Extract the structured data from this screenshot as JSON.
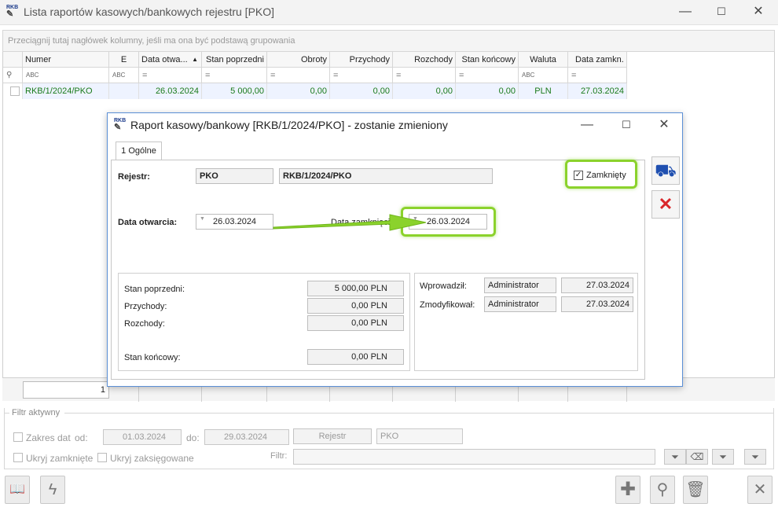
{
  "window": {
    "logo": "RKB",
    "title": "Lista raportów kasowych/bankowych rejestru [PKO]",
    "min": "—",
    "max": "☐",
    "close": "✕"
  },
  "grid": {
    "group_hint": "Przeciągnij tutaj nagłówek kolumny, jeśli ma ona być podstawą grupowania",
    "columns": [
      "Numer",
      "E",
      "Data otwa...",
      "Stan poprzedni",
      "Obroty",
      "Przychody",
      "Rozchody",
      "Stan końcowy",
      "Waluta",
      "Data zamkn."
    ],
    "sort_indicator": "▲",
    "filters": [
      "ABC",
      "ABC",
      "=",
      "=",
      "=",
      "=",
      "=",
      "=",
      "ABC",
      "="
    ],
    "row": [
      "RKB/1/2024/PKO",
      "",
      "26.03.2024",
      "5 000,00",
      "0,00",
      "0,00",
      "0,00",
      "0,00",
      "PLN",
      "27.03.2024"
    ],
    "footer_count": "1"
  },
  "filter_panel": {
    "legend": "Filtr aktywny",
    "date_range": "Zakres dat",
    "from_label": "od:",
    "from_value": "01.03.2024",
    "to_label": "do:",
    "to_value": "29.03.2024",
    "register_button": "Rejestr",
    "register_value": "PKO",
    "hide_closed": "Ukryj zamknięte",
    "hide_posted": "Ukryj zaksięgowane",
    "filter_label": "Filtr:"
  },
  "dialog": {
    "logo": "RKB",
    "title": "Raport kasowy/bankowy [RKB/1/2024/PKO] - zostanie zmieniony",
    "tab": "1 Ogólne",
    "register_label": "Rejestr:",
    "register_code": "PKO",
    "register_number": "RKB/1/2024/PKO",
    "closed_checkbox": "Zamknięty",
    "open_date_label": "Data otwarcia:",
    "open_date": "26.03.2024",
    "close_date_label": "Data zamknięcia:",
    "close_date": "26.03.2024",
    "prev_balance_label": "Stan poprzedni:",
    "prev_balance": "5 000,00 PLN",
    "income_label": "Przychody:",
    "income": "0,00 PLN",
    "expense_label": "Rozchody:",
    "expense": "0,00 PLN",
    "end_balance_label": "Stan końcowy:",
    "end_balance": "0,00 PLN",
    "entered_label": "Wprowadził:",
    "entered_by": "Administrator",
    "entered_date": "27.03.2024",
    "modified_label": "Zmodyfikował:",
    "modified_by": "Administrator",
    "modified_date": "27.03.2024"
  },
  "colors": {
    "highlight": "#8bd22c",
    "row_text": "#1a7a1a",
    "dialog_border": "#5b8fd6",
    "cancel_red": "#d9262a"
  }
}
